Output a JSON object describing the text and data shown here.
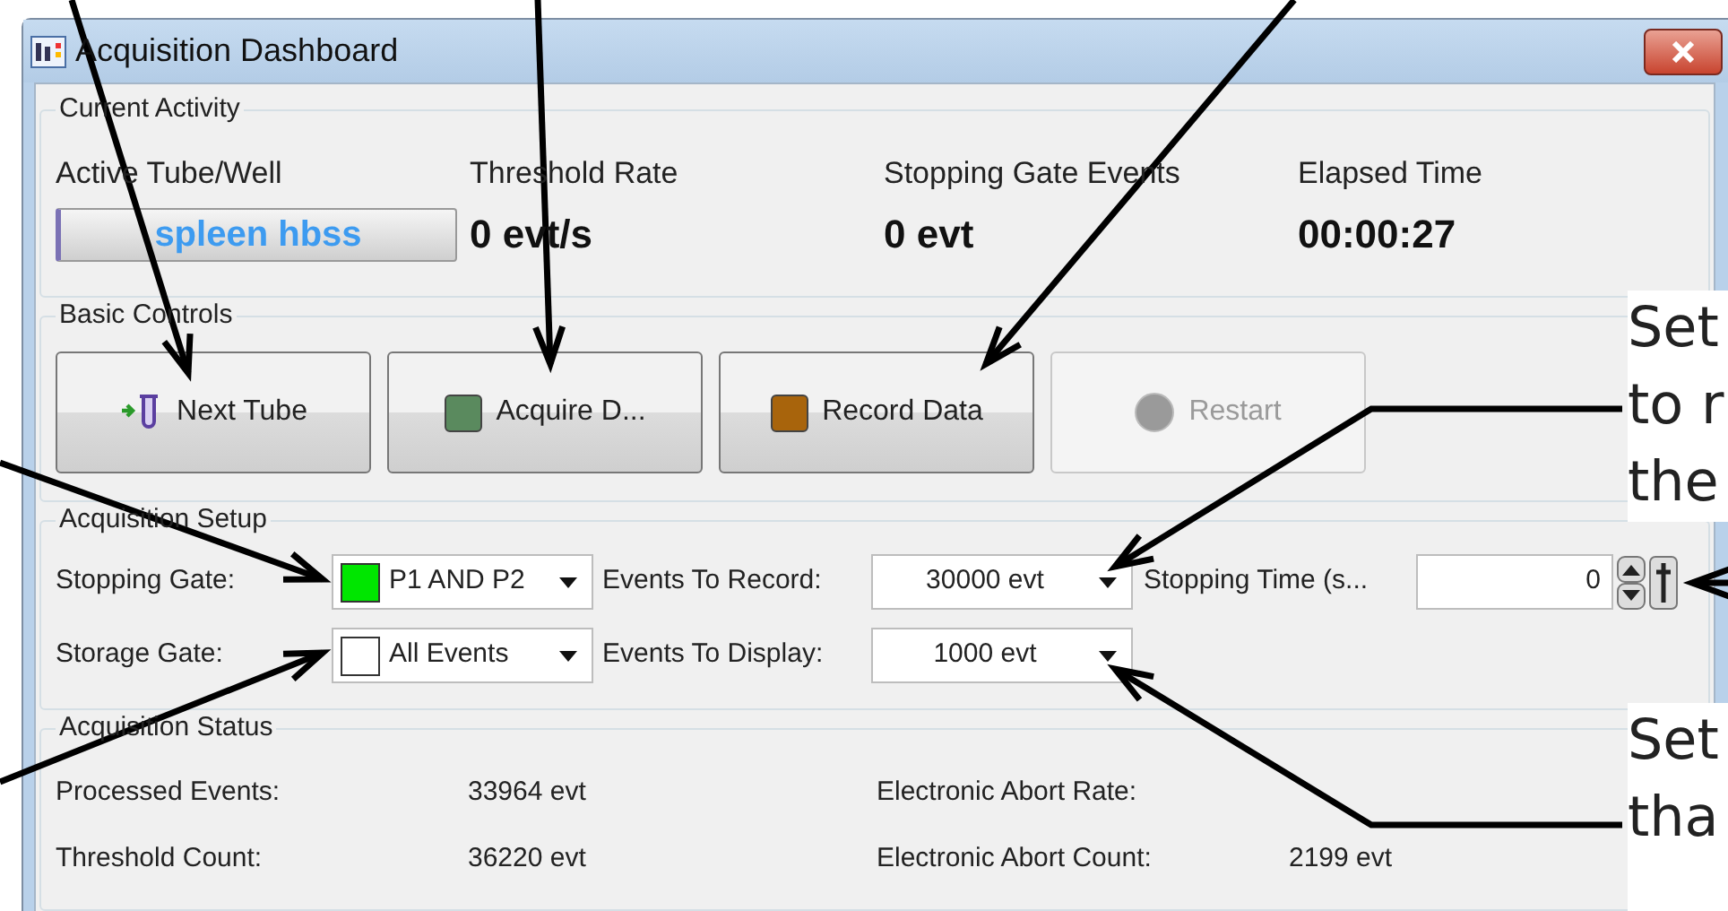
{
  "window": {
    "title": "Acquisition Dashboard"
  },
  "current_activity": {
    "title": "Current Activity",
    "fields": [
      {
        "kind": "tube",
        "label": "Active Tube/Well",
        "value": "spleen hbss"
      },
      {
        "kind": "reading",
        "label": "Threshold Rate",
        "value": "0 evt/s"
      },
      {
        "kind": "reading",
        "label": "Stopping Gate Events",
        "value": "0 evt"
      },
      {
        "kind": "reading",
        "label": "Elapsed Time",
        "value": "00:00:27"
      }
    ]
  },
  "basic_controls": {
    "title": "Basic Controls",
    "buttons": [
      {
        "label": "Next Tube",
        "kind": "tube",
        "disabled": false
      },
      {
        "label": "Acquire D...",
        "kind": "square",
        "color": "#5a8a5e",
        "disabled": false
      },
      {
        "label": "Record Data",
        "kind": "square",
        "color": "#a8640c",
        "disabled": false
      },
      {
        "label": "Restart",
        "kind": "circle",
        "disabled": true
      }
    ]
  },
  "acquisition_setup": {
    "title": "Acquisition Setup",
    "stopping_gate": {
      "label": "Stopping Gate:",
      "value": "P1 AND P2",
      "color": "#00e600"
    },
    "storage_gate": {
      "label": "Storage Gate:",
      "value": "All Events",
      "color": "#ffffff"
    },
    "events_to_record": {
      "label": "Events To Record:",
      "value": "30000 evt"
    },
    "events_to_display": {
      "label": "Events To Display:",
      "value": "1000 evt"
    },
    "stopping_time": {
      "label": "Stopping Time (s...",
      "value": "0"
    }
  },
  "acquisition_status": {
    "title": "Acquisition Status",
    "rows": [
      [
        {
          "label": "Processed Events:",
          "value": "33964 evt"
        },
        {
          "label": "Electronic Abort Rate:"
        }
      ],
      [
        {
          "label": "Threshold Count:",
          "value": "36220 evt"
        },
        {
          "label": "Electronic Abort Count:",
          "value": "2199 evt"
        }
      ]
    ]
  },
  "callouts": [
    {
      "lines": [
        "Set",
        "to r",
        "the"
      ]
    },
    {
      "lines": [
        "Set",
        "tha"
      ]
    }
  ]
}
